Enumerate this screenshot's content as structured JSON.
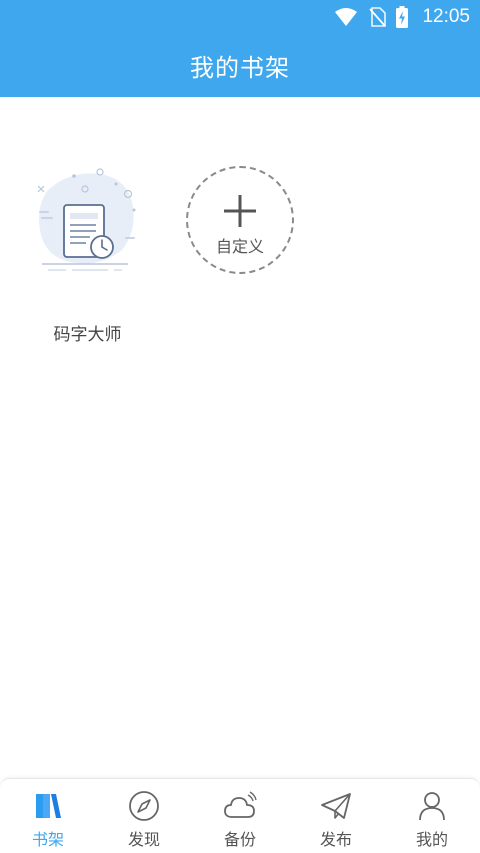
{
  "status_bar": {
    "time": "12:05",
    "icons": [
      "wifi-icon",
      "no-sim-icon",
      "battery-charging-icon"
    ]
  },
  "header": {
    "title": "我的书架"
  },
  "shelf": {
    "books": [
      {
        "title": "码字大师",
        "cover_icon": "document-clock-icon"
      }
    ],
    "add_custom": {
      "label": "自定义",
      "icon": "plus-icon"
    }
  },
  "tabbar": {
    "tabs": [
      {
        "label": "书架",
        "icon": "bookshelf-icon",
        "active": true
      },
      {
        "label": "发现",
        "icon": "compass-icon",
        "active": false
      },
      {
        "label": "备份",
        "icon": "cloud-icon",
        "active": false
      },
      {
        "label": "发布",
        "icon": "paper-plane-icon",
        "active": false
      },
      {
        "label": "我的",
        "icon": "user-icon",
        "active": false
      }
    ]
  },
  "colors": {
    "accent": "#3ea7ee",
    "text": "#444444",
    "muted": "#888888"
  }
}
